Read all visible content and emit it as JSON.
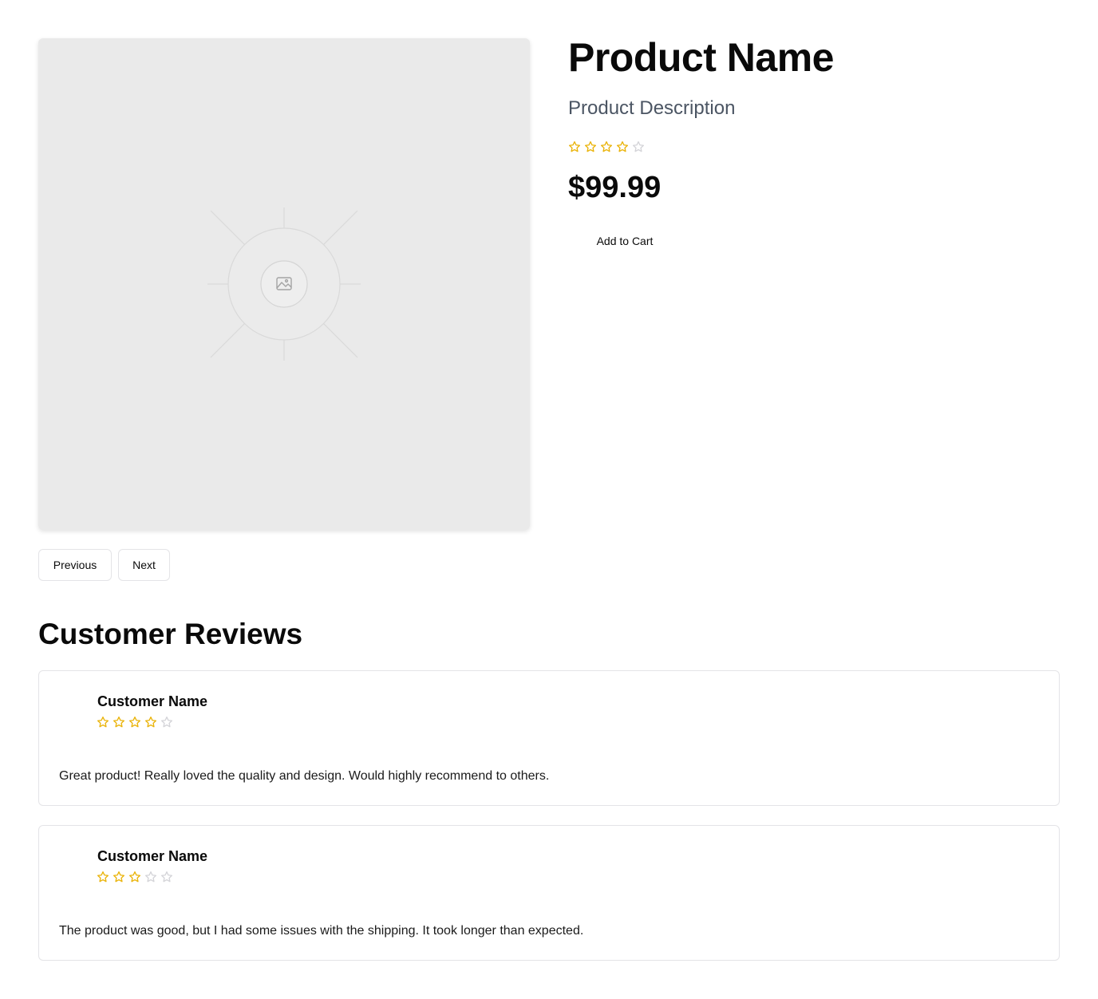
{
  "product": {
    "title": "Product Name",
    "description": "Product Description",
    "rating": 4,
    "rating_max": 5,
    "price": "$99.99",
    "add_to_cart_label": "Add to Cart",
    "image_icon": "image-placeholder-icon"
  },
  "carousel": {
    "previous_label": "Previous",
    "next_label": "Next"
  },
  "reviews": {
    "heading": "Customer Reviews",
    "items": [
      {
        "name": "Customer Name",
        "rating": 4,
        "text": "Great product! Really loved the quality and design. Would highly recommend to others."
      },
      {
        "name": "Customer Name",
        "rating": 3,
        "text": "The product was good, but I had some issues with the shipping. It took longer than expected."
      }
    ]
  },
  "colors": {
    "star_filled": "#eab308",
    "star_empty": "#d4d4d8",
    "description": "#4b5563",
    "image_bg": "#eaeaea"
  }
}
